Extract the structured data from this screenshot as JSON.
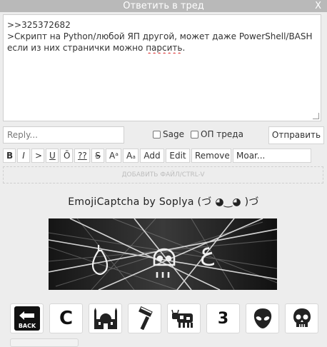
{
  "window": {
    "title": "Ответить в тред",
    "close_label": "X"
  },
  "message": {
    "line1": ">>325372682",
    "line2": ">Скрипт на Python/любой ЯП другой, может даже PowerShell/BASH",
    "line3a": "если из них странички можно ",
    "line3b": "парсить",
    "line3c": "."
  },
  "form": {
    "name_placeholder": "Reply...",
    "sage_label": "Sage",
    "op_label": "ОП треда",
    "send_label": "Отправить"
  },
  "toolbar": {
    "bold": "B",
    "italic": "I",
    "quote": ">",
    "underline": "U",
    "overline": "Ō",
    "spoiler": "??",
    "strike": "S",
    "sup": "Aᵃ",
    "sub": "Aₐ",
    "add": "Add",
    "edit": "Edit",
    "remove": "Remove",
    "more": "Moar..."
  },
  "upload": {
    "label": "ДОБАВИТЬ ФАЙЛ/CTRL-V"
  },
  "captcha": {
    "title": "EmojiCaptcha by Soplya (づ ◕‿◕ )づ",
    "keys": [
      "back-icon",
      "letter-c-icon",
      "mosque-icon",
      "razor-icon",
      "cow-icon",
      "digit-3-icon",
      "alien-icon",
      "skull-icon"
    ],
    "key_c": "C",
    "key_3": "3",
    "back_text": "BACK"
  }
}
